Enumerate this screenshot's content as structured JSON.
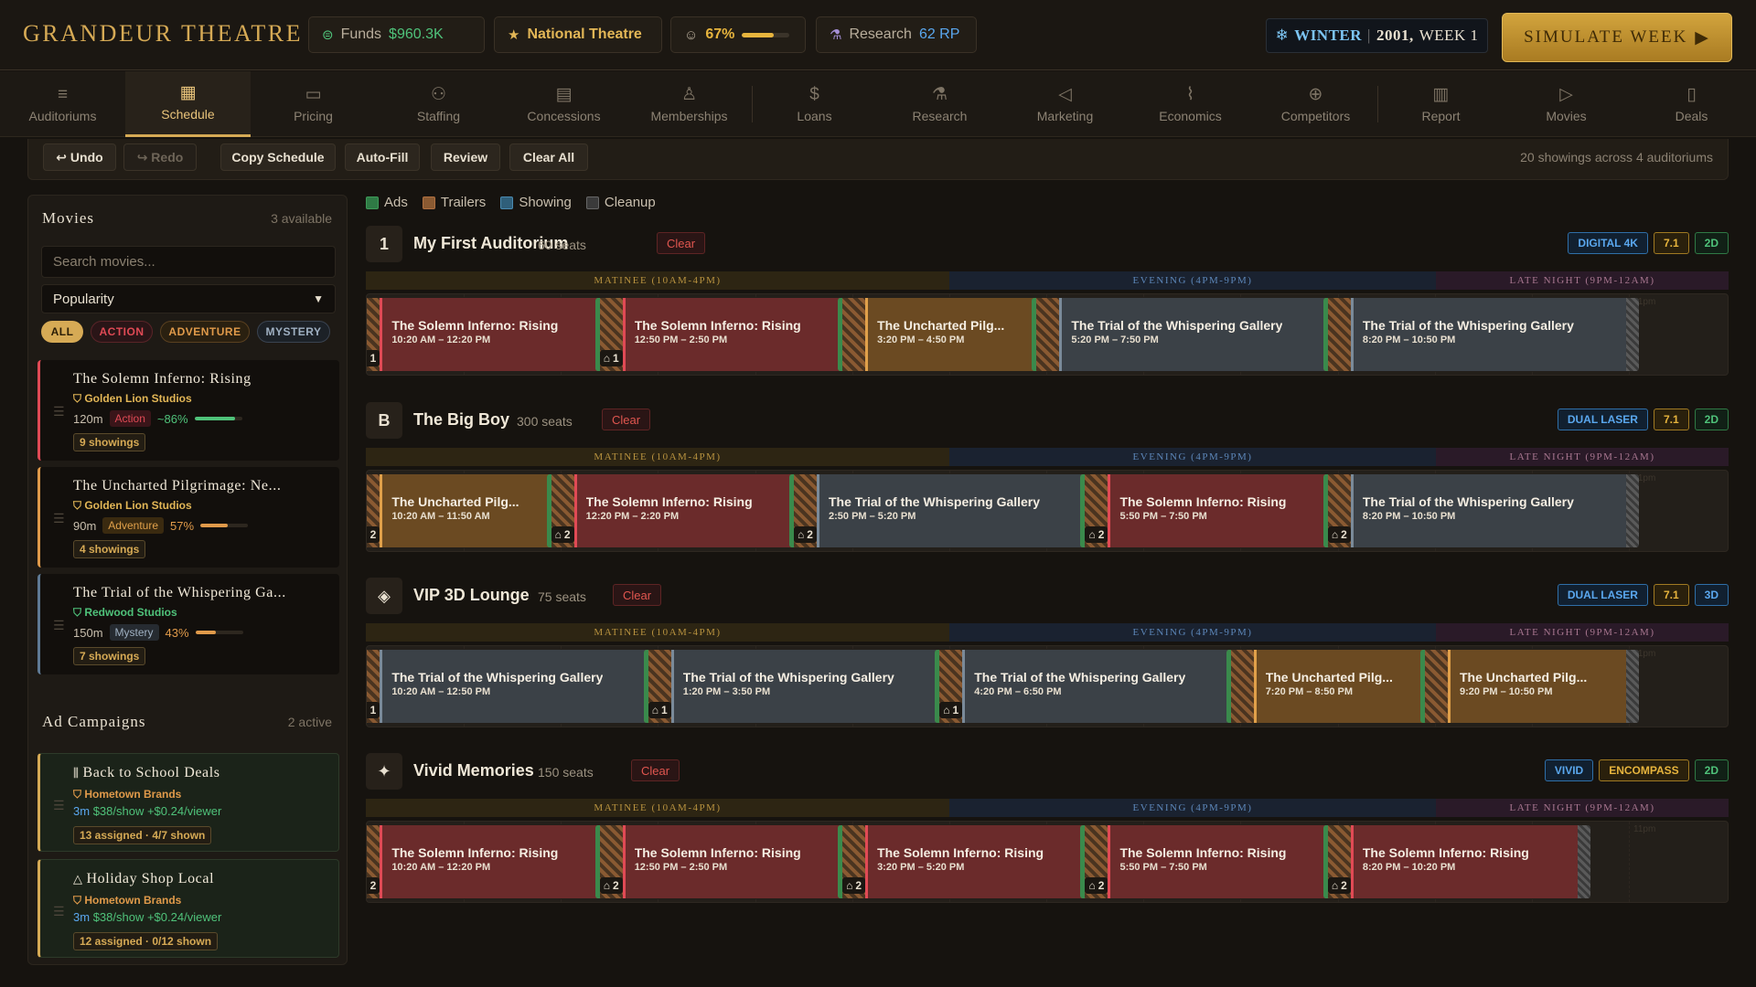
{
  "brand": "GRANDEUR THEATRE",
  "funds": {
    "label": "Funds",
    "value": "$960.3K"
  },
  "theatre_tier": "National Theatre",
  "reputation": {
    "value": "67%",
    "fraction": 0.67
  },
  "research": {
    "label": "Research",
    "value": "62 RP"
  },
  "season": {
    "name": "WINTER",
    "sep": "|",
    "year": "2001,",
    "week": "WEEK 1"
  },
  "simulate_label": "SIMULATE WEEK",
  "nav": [
    "Auditoriums",
    "Schedule",
    "Pricing",
    "Staffing",
    "Concessions",
    "Memberships",
    "Loans",
    "Research",
    "Marketing",
    "Economics",
    "Competitors",
    "Report",
    "Movies",
    "Deals"
  ],
  "toolbar": {
    "undo": "↩ Undo",
    "redo": "↪ Redo",
    "copy": "Copy Schedule",
    "autofill": "Auto-Fill",
    "review": "Review",
    "clear_all": "Clear All",
    "summary": "20 showings across 4 auditoriums"
  },
  "movies_panel": {
    "title": "Movies",
    "count": "3 available",
    "search_placeholder": "Search movies...",
    "sort": "Popularity",
    "filters": [
      "ALL",
      "ACTION",
      "ADVENTURE",
      "MYSTERY"
    ],
    "items": [
      {
        "title": "The Solemn Inferno: Rising",
        "studio": "Golden Lion Studios",
        "runtime": "120m",
        "genre": "Action",
        "popularity": "~86%",
        "pop_fraction": 0.86,
        "showings": "9 showings"
      },
      {
        "title": "The Uncharted Pilgrimage: Ne...",
        "studio": "Golden Lion Studios",
        "runtime": "90m",
        "genre": "Adventure",
        "popularity": "57%",
        "pop_fraction": 0.57,
        "showings": "4 showings"
      },
      {
        "title": "The Trial of the Whispering Ga...",
        "studio": "Redwood Studios",
        "runtime": "150m",
        "genre": "Mystery",
        "popularity": "43%",
        "pop_fraction": 0.43,
        "showings": "7 showings"
      }
    ]
  },
  "ads_panel": {
    "title": "Ad Campaigns",
    "count": "2 active",
    "items": [
      {
        "title": "Back to School Deals",
        "brand": "Hometown Brands",
        "duration": "3m",
        "price": "$38/show",
        "per_viewer": "+$0.24/viewer",
        "status": "13 assigned · 4/7 shown"
      },
      {
        "title": "Holiday Shop Local",
        "brand": "Hometown Brands",
        "duration": "3m",
        "price": "$38/show",
        "per_viewer": "+$0.24/viewer",
        "status": "12 assigned · 0/12 shown"
      }
    ]
  },
  "legend": [
    "Ads",
    "Trailers",
    "Showing",
    "Cleanup"
  ],
  "periods": [
    "MATINEE (10AM-4PM)",
    "EVENING (4PM-9PM)",
    "LATE NIGHT (9PM-12AM)"
  ],
  "hour_marks": [
    "11am",
    "12pm",
    "1pm",
    "2pm",
    "3pm",
    "4pm",
    "5pm",
    "6pm",
    "7pm",
    "8pm",
    "9pm",
    "10pm",
    "11pm"
  ],
  "clear_label": "Clear",
  "auditoriums": [
    {
      "icon": "1",
      "name": "My First Auditorium",
      "seats": "60 seats",
      "tags": [
        "DIGITAL 4K",
        "7.1",
        "2D"
      ],
      "showings": [
        {
          "movie": "The Solemn Inferno: Rising",
          "time": "10:20 AM – 12:20 PM",
          "crew": "1"
        },
        {
          "movie": "The Solemn Inferno: Rising",
          "time": "12:50 PM – 2:50 PM",
          "crew": "1"
        },
        {
          "movie": "The Uncharted Pilg...",
          "time": "3:20 PM – 4:50 PM",
          "crew": ""
        },
        {
          "movie": "The Trial of the Whispering Gallery",
          "time": "5:20 PM – 7:50 PM",
          "crew": ""
        },
        {
          "movie": "The Trial of the Whispering Gallery",
          "time": "8:20 PM – 10:50 PM",
          "crew": ""
        }
      ]
    },
    {
      "icon": "B",
      "name": "The Big Boy",
      "seats": "300 seats",
      "tags": [
        "DUAL LASER",
        "7.1",
        "2D"
      ],
      "showings": [
        {
          "movie": "The Uncharted Pilg...",
          "time": "10:20 AM – 11:50 AM",
          "crew": "2"
        },
        {
          "movie": "The Solemn Inferno: Rising",
          "time": "12:20 PM – 2:20 PM",
          "crew": "2"
        },
        {
          "movie": "The Trial of the Whispering Gallery",
          "time": "2:50 PM – 5:20 PM",
          "crew": "2"
        },
        {
          "movie": "The Solemn Inferno: Rising",
          "time": "5:50 PM – 7:50 PM",
          "crew": "2"
        },
        {
          "movie": "The Trial of the Whispering Gallery",
          "time": "8:20 PM – 10:50 PM",
          "crew": "2"
        }
      ]
    },
    {
      "icon": "◈",
      "name": "VIP 3D Lounge",
      "seats": "75 seats",
      "tags": [
        "DUAL LASER",
        "7.1",
        "3D"
      ],
      "showings": [
        {
          "movie": "The Trial of the Whispering Gallery",
          "time": "10:20 AM – 12:50 PM",
          "crew": "1"
        },
        {
          "movie": "The Trial of the Whispering Gallery",
          "time": "1:20 PM – 3:50 PM",
          "crew": "1"
        },
        {
          "movie": "The Trial of the Whispering Gallery",
          "time": "4:20 PM – 6:50 PM",
          "crew": "1"
        },
        {
          "movie": "The Uncharted Pilg...",
          "time": "7:20 PM – 8:50 PM",
          "crew": ""
        },
        {
          "movie": "The Uncharted Pilg...",
          "time": "9:20 PM – 10:50 PM",
          "crew": ""
        }
      ]
    },
    {
      "icon": "✦",
      "name": "Vivid Memories",
      "seats": "150 seats",
      "tags": [
        "VIVID",
        "ENCOMPASS",
        "2D"
      ],
      "showings": [
        {
          "movie": "The Solemn Inferno: Rising",
          "time": "10:20 AM – 12:20 PM",
          "crew": "2"
        },
        {
          "movie": "The Solemn Inferno: Rising",
          "time": "12:50 PM – 2:50 PM",
          "crew": "2"
        },
        {
          "movie": "The Solemn Inferno: Rising",
          "time": "3:20 PM – 5:20 PM",
          "crew": "2"
        },
        {
          "movie": "The Solemn Inferno: Rising",
          "time": "5:50 PM – 7:50 PM",
          "crew": "2"
        },
        {
          "movie": "The Solemn Inferno: Rising",
          "time": "8:20 PM – 10:20 PM",
          "crew": "2"
        }
      ]
    }
  ]
}
